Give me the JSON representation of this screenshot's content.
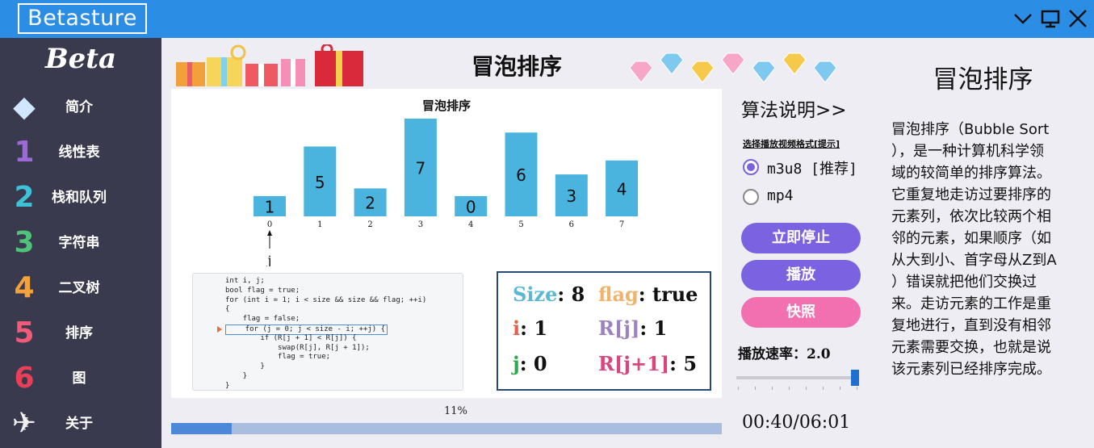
{
  "window": {
    "title": "Betasture"
  },
  "sidebar": {
    "brand": "Beta",
    "items": [
      {
        "label": "简介",
        "icon": "diamond-icon",
        "glyph": "◆",
        "color": "#cfe8ff"
      },
      {
        "label": "线性表",
        "icon": "number-1-icon",
        "glyph": "1",
        "color": "#9b6ad6"
      },
      {
        "label": "栈和队列",
        "icon": "number-2-icon",
        "glyph": "2",
        "color": "#3ec2d8"
      },
      {
        "label": "字符串",
        "icon": "number-3-icon",
        "glyph": "3",
        "color": "#4ec47a"
      },
      {
        "label": "二叉树",
        "icon": "number-4-icon",
        "glyph": "4",
        "color": "#f4a33a"
      },
      {
        "label": "排序",
        "icon": "number-5-icon",
        "glyph": "5",
        "color": "#f25a7a"
      },
      {
        "label": "图",
        "icon": "number-6-icon",
        "glyph": "6",
        "color": "#e9405a"
      },
      {
        "label": "关于",
        "icon": "origami-bird-icon",
        "glyph": "✈",
        "color": "#f0f0f0"
      }
    ]
  },
  "banner": {
    "title": "冒泡排序"
  },
  "chart_data": {
    "type": "bar",
    "title": "冒泡排序",
    "categories": [
      "0",
      "1",
      "2",
      "3",
      "4",
      "5",
      "6",
      "7"
    ],
    "values": [
      1,
      5,
      2,
      7,
      0,
      6,
      3,
      4
    ],
    "bar_color": "#4ab4de",
    "pointer": {
      "label": "j",
      "index": 0
    }
  },
  "code": [
    "int i, j;",
    "bool flag = true;",
    "for (int i = 1; i < size && size && flag; ++i)",
    "{",
    "    flag = false;",
    "    for (j = 0; j < size - i; ++j) {",
    "        if (R[j + 1] < R[j]) {",
    "            swap(R[j], R[j + 1]);",
    "            flag = true;",
    "        }",
    "    }",
    "}"
  ],
  "code_current_line": 5,
  "variables": [
    {
      "name": "Size",
      "colon": ":",
      "value": "8",
      "color": "#5ab7d8"
    },
    {
      "name": "flag",
      "colon": ":",
      "value": "true",
      "color": "#f0b36b"
    },
    {
      "name": "i",
      "colon": ":",
      "value": "1",
      "color": "#e0604a"
    },
    {
      "name": "R[j]",
      "colon": ":",
      "value": "1",
      "color": "#9a83c0"
    },
    {
      "name": "j",
      "colon": ":",
      "value": "0",
      "color": "#2fa84e"
    },
    {
      "name": "R[j+1]",
      "colon": ":",
      "value": "5",
      "color": "#d8467e"
    }
  ],
  "progress": {
    "label": "11%",
    "fraction": 0.11
  },
  "controls": {
    "algo_link": "算法说明>>",
    "format_hint": "选择播放视频格式[提示]",
    "formats": [
      {
        "label": "m3u8 [推荐]",
        "checked": true
      },
      {
        "label": "mp4",
        "checked": false
      }
    ],
    "buttons": [
      {
        "label": "立即停止",
        "color": "#7b62e0"
      },
      {
        "label": "播放",
        "color": "#7b62e0"
      },
      {
        "label": "快照",
        "color": "#f26fb0"
      }
    ],
    "speed_label": "播放速率：2.0",
    "speed_fraction": 0.98,
    "timer": "00:40/06:01"
  },
  "info": {
    "title": "冒泡排序",
    "lines": [
      "冒泡排序（Bubble Sort",
      "），是一种计算机科学领",
      "域的较简单的排序算法。",
      "它重复地走访过要排序的",
      "元素列，依次比较两个相",
      "邻的元素，如果顺序（如",
      "从大到小、首字母从Z到A",
      "）错误就把他们交换过",
      "来。走访元素的工作是重",
      "复地进行，直到没有相邻",
      "元素需要交换，也就是说",
      "该元素列已经排序完成。"
    ]
  }
}
